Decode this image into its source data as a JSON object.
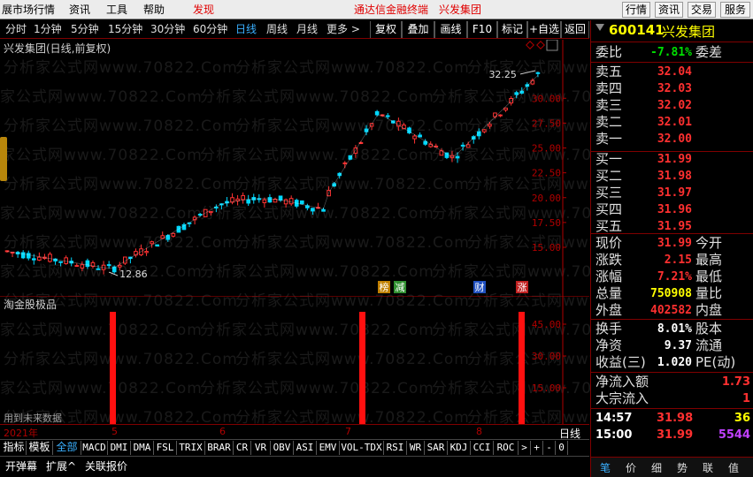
{
  "menubar": {
    "items": [
      "展市场行情",
      "资讯",
      "工具",
      "帮助"
    ],
    "discover": "发现",
    "center_links": [
      "通达信金融终端",
      "兴发集团"
    ],
    "right_buttons": [
      "行情",
      "资讯",
      "交易",
      "服务"
    ]
  },
  "periods": [
    "分时",
    "1分钟",
    "5分钟",
    "15分钟",
    "30分钟",
    "60分钟",
    "日线",
    "周线",
    "月线",
    "更多 >"
  ],
  "active_period": "日线",
  "tools": [
    "复权",
    "叠加",
    "画线",
    "F10",
    "标记",
    "+自选",
    "返回"
  ],
  "chart": {
    "title": "兴发集团(日线,前复权)",
    "high_label": "32.25",
    "low_label": "12.86",
    "y_ticks": [
      "30.00",
      "27.50",
      "25.00",
      "22.50",
      "20.00",
      "17.50",
      "15.00"
    ],
    "events": [
      "榜",
      "减",
      "财",
      "涨"
    ],
    "indicator_title": "淘金股极品",
    "indicator_ticks": [
      "45.00",
      "30.00",
      "15.00"
    ],
    "future_note": "用到未来数据",
    "date_labels": [
      "2021年",
      "5",
      "6",
      "7",
      "8"
    ],
    "period_label": "日线",
    "watermark": "分析家公式网www.70822.Com"
  },
  "indicator_tabs": [
    "指标",
    "模板",
    "全部",
    "MACD",
    "DMI",
    "DMA",
    "FSL",
    "TRIX",
    "BRAR",
    "CR",
    "VR",
    "OBV",
    "ASI",
    "EMV",
    "VOL-TDX",
    "RSI",
    "WR",
    "SAR",
    "KDJ",
    "CCI",
    "ROC",
    ">",
    "+",
    "-",
    "0"
  ],
  "active_indicator_tab": "全部",
  "bottom_bar": [
    "开弹幕",
    "扩展^",
    "关联报价"
  ],
  "quote": {
    "code": "600141",
    "name": "兴发集团",
    "weibi_label": "委比",
    "weibi": "-7.81%",
    "weicha_label": "委差",
    "sells": [
      {
        "label": "卖五",
        "price": "32.04"
      },
      {
        "label": "卖四",
        "price": "32.03"
      },
      {
        "label": "卖三",
        "price": "32.02"
      },
      {
        "label": "卖二",
        "price": "32.01"
      },
      {
        "label": "卖一",
        "price": "32.00"
      }
    ],
    "buys": [
      {
        "label": "买一",
        "price": "31.99"
      },
      {
        "label": "买二",
        "price": "31.98"
      },
      {
        "label": "买三",
        "price": "31.97"
      },
      {
        "label": "买四",
        "price": "31.96"
      },
      {
        "label": "买五",
        "price": "31.95"
      }
    ],
    "stats": [
      {
        "label": "现价",
        "value": "31.99",
        "label2": "今开",
        "color": "red"
      },
      {
        "label": "涨跌",
        "value": "2.15",
        "label2": "最高",
        "color": "red"
      },
      {
        "label": "涨幅",
        "value": "7.21%",
        "label2": "最低",
        "color": "red"
      },
      {
        "label": "总量",
        "value": "750908",
        "label2": "量比",
        "color": "yellow"
      },
      {
        "label": "外盘",
        "value": "402582",
        "label2": "内盘",
        "color": "red"
      }
    ],
    "stats2": [
      {
        "label": "换手",
        "value": "8.01%",
        "label2": "股本"
      },
      {
        "label": "净资",
        "value": "9.37",
        "label2": "流通"
      },
      {
        "label": "收益(三)",
        "value": "1.020",
        "label2": "PE(动)"
      }
    ],
    "flows": [
      {
        "label": "净流入额",
        "value": "1.73"
      },
      {
        "label": "大宗流入",
        "value": "1"
      }
    ],
    "ticks": [
      {
        "time": "14:57",
        "price": "31.98",
        "vol": "36"
      },
      {
        "time": "15:00",
        "price": "31.99",
        "vol": "5544"
      }
    ],
    "tabs": [
      "笔",
      "价",
      "细",
      "势",
      "联",
      "值"
    ],
    "active_tab": "笔"
  }
}
